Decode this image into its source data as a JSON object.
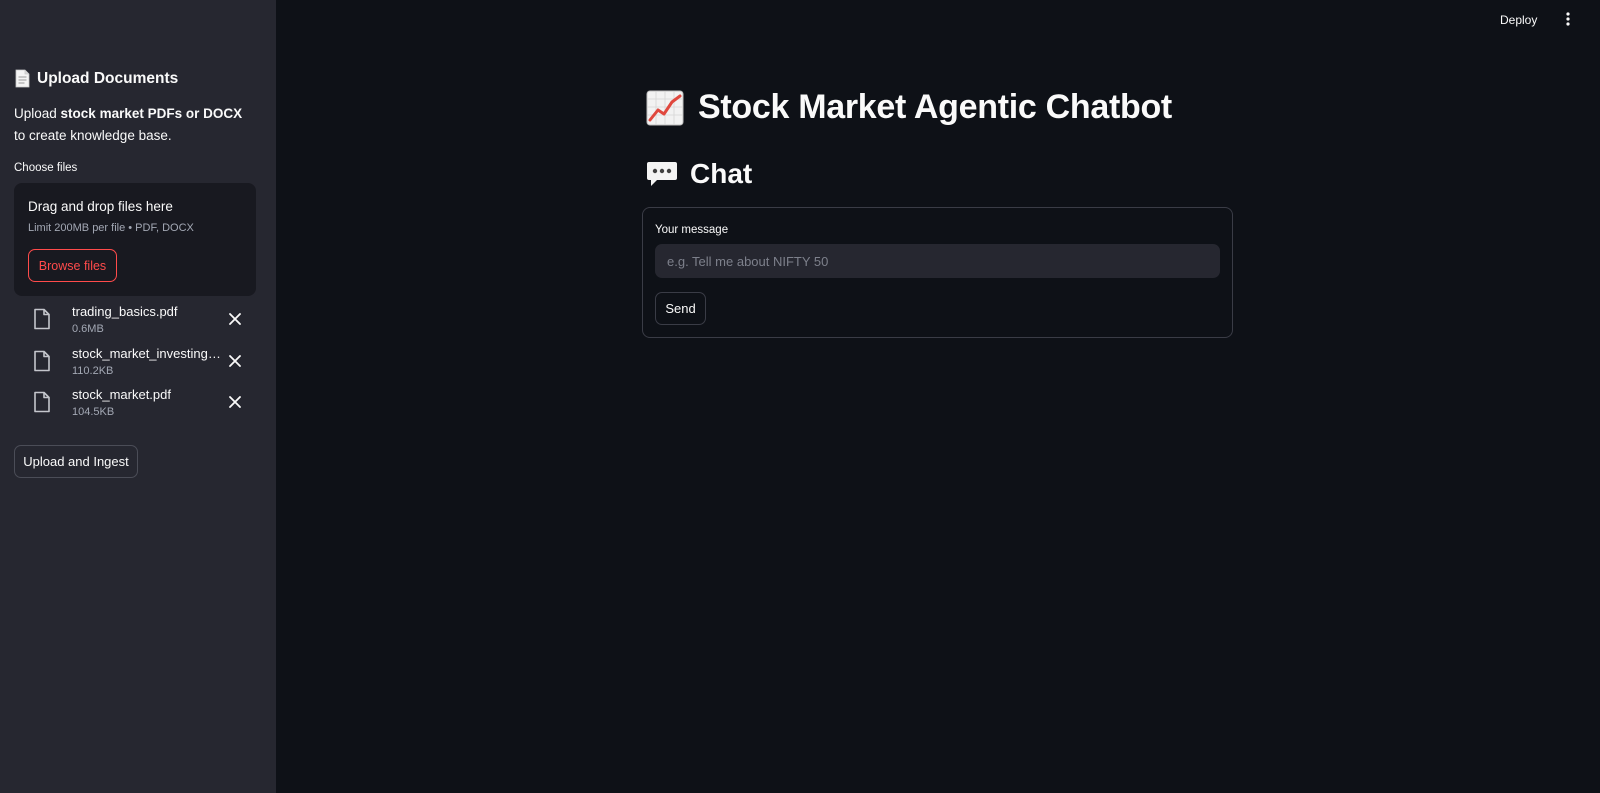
{
  "sidebar": {
    "header_title": "Upload Documents",
    "description_prefix": "Upload ",
    "description_bold": "stock market PDFs or DOCX",
    "description_suffix": " to create knowledge base.",
    "uploader_label": "Choose files",
    "dropzone": {
      "title": "Drag and drop files here",
      "limit_text": "Limit 200MB per file • PDF, DOCX",
      "browse_label": "Browse files"
    },
    "files": [
      {
        "name": "trading_basics.pdf",
        "size": "0.6MB"
      },
      {
        "name": "stock_market_investing_basics.pdf",
        "size": "110.2KB"
      },
      {
        "name": "stock_market.pdf",
        "size": "104.5KB"
      }
    ],
    "upload_button_label": "Upload and Ingest"
  },
  "topbar": {
    "deploy_label": "Deploy",
    "menu_icon": "kebab-menu-icon"
  },
  "main": {
    "title": "Stock Market Agentic Chatbot",
    "title_icon": "chart-increasing-icon",
    "chat_heading": "Chat",
    "chat_icon": "speech-balloon-icon",
    "form": {
      "message_label": "Your message",
      "message_value": "",
      "message_placeholder": "e.g. Tell me about NIFTY 50",
      "send_label": "Send"
    }
  },
  "colors": {
    "background": "#0e1117",
    "sidebar": "#262730",
    "accent": "#ff4b4b",
    "text": "#fafafa"
  }
}
